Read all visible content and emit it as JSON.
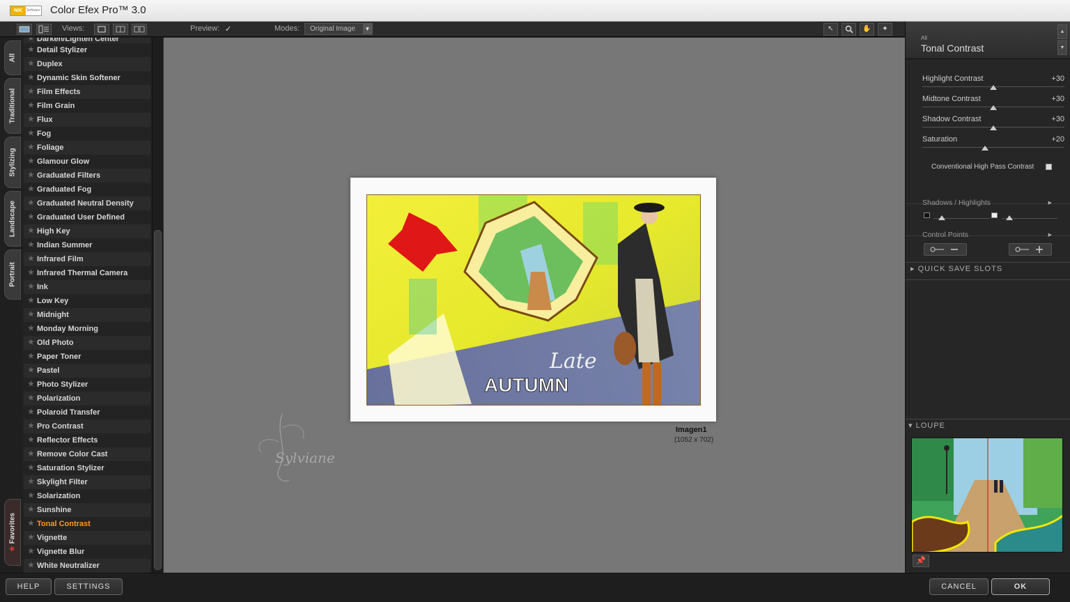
{
  "window": {
    "title": "Color Efex Pro™ 3.0",
    "logo_text": "NIK",
    "logo_sub": "Software"
  },
  "toolbar": {
    "views_label": "Views:",
    "preview_label": "Preview:",
    "preview_check": "✓",
    "modes_label": "Modes:",
    "mode_value": "Original Image",
    "tools": [
      "arrow-tool",
      "zoom-tool",
      "hand-tool",
      "control-point-tool"
    ]
  },
  "category_tabs": [
    "All",
    "Traditional",
    "Stylizing",
    "Landscape",
    "Portrait",
    "Favorites"
  ],
  "filters": {
    "partial_top": "Darken/Lighten Center",
    "items": [
      "Detail Stylizer",
      "Duplex",
      "Dynamic Skin Softener",
      "Film Effects",
      "Film Grain",
      "Flux",
      "Fog",
      "Foliage",
      "Glamour Glow",
      "Graduated Filters",
      "Graduated Fog",
      "Graduated Neutral Density",
      "Graduated User Defined",
      "High Key",
      "Indian Summer",
      "Infrared Film",
      "Infrared Thermal Camera",
      "Ink",
      "Low Key",
      "Midnight",
      "Monday Morning",
      "Old Photo",
      "Paper Toner",
      "Pastel",
      "Photo Stylizer",
      "Polarization",
      "Polaroid Transfer",
      "Pro Contrast",
      "Reflector Effects",
      "Remove Color Cast",
      "Saturation Stylizer",
      "Skylight Filter",
      "Solarization",
      "Sunshine",
      "Tonal Contrast",
      "Vignette",
      "Vignette Blur",
      "White Neutralizer"
    ],
    "selected": "Tonal Contrast"
  },
  "image": {
    "name": "Imagen1",
    "dims": "(1052 x 702)",
    "text_late": "Late",
    "text_autumn": "AUTUMN",
    "watermark": "Sylviane"
  },
  "panel": {
    "category": "All",
    "filter_name": "Tonal Contrast",
    "sliders": [
      {
        "label": "Highlight Contrast",
        "value": "+30",
        "level": 0.5
      },
      {
        "label": "Midtone Contrast",
        "value": "+30",
        "level": 0.5
      },
      {
        "label": "Shadow Contrast",
        "value": "+30",
        "level": 0.5
      },
      {
        "label": "Saturation",
        "value": "+20",
        "level": 0.44
      }
    ],
    "checkbox_label": "Conventional High Pass Contrast",
    "shadows_highlights": "Shadows / Highlights",
    "control_points": "Control Points",
    "quick_save": "QUICK SAVE SLOTS",
    "loupe": "LOUPE"
  },
  "buttons": {
    "help": "HELP",
    "settings": "SETTINGS",
    "cancel": "CANCEL",
    "ok": "OK"
  },
  "colors": {
    "selected_filter": "#ff9a1a",
    "canvas_bg": "#777777",
    "panel_bg": "#262626"
  }
}
